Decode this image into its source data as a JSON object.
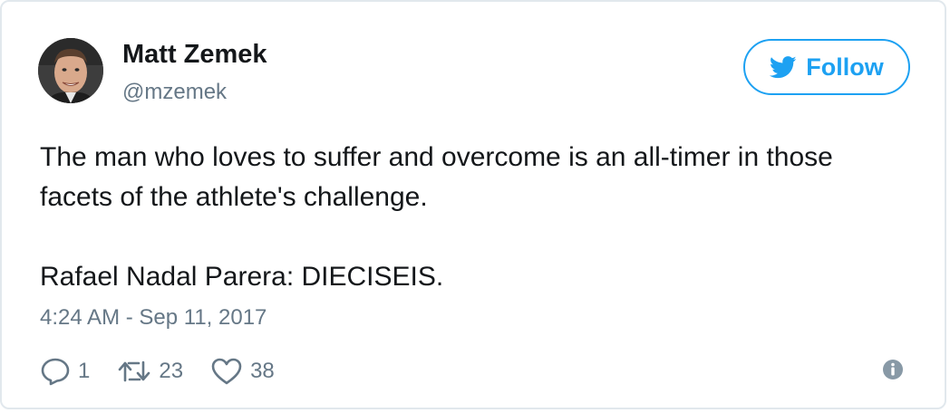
{
  "author": {
    "name": "Matt Zemek",
    "handle": "@mzemek",
    "avatar_icon": "profile-photo"
  },
  "follow_button": {
    "label": "Follow",
    "icon": "twitter-bird-icon",
    "color": "#1da1f2"
  },
  "tweet": {
    "lines": [
      "The man who loves to suffer and overcome is an all-timer in those",
      "facets of the athlete's challenge.",
      "Rafael Nadal Parera: DIECISEIS."
    ],
    "timestamp": "4:24 AM - Sep 11, 2017"
  },
  "actions": {
    "reply": {
      "icon": "reply-icon",
      "count": "1"
    },
    "retweet": {
      "icon": "retweet-icon",
      "count": "23"
    },
    "like": {
      "icon": "heart-icon",
      "count": "38"
    },
    "info": {
      "icon": "info-icon"
    }
  },
  "colors": {
    "text": "#14171a",
    "muted": "#657786",
    "border": "#e1e8ed",
    "accent": "#1da1f2"
  }
}
